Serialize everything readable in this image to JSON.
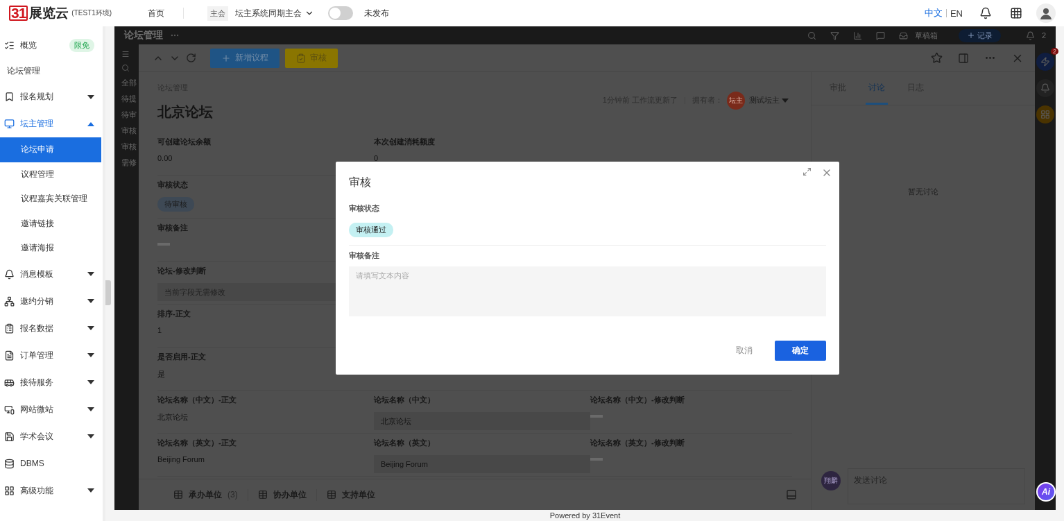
{
  "header": {
    "logo_mark": "31",
    "logo_text": "展览云",
    "env": "(TEST1环境)",
    "nav": [
      {
        "label": "首页"
      }
    ],
    "event_tag": "主会",
    "event_name": "坛主系统同期主会",
    "publish_toggle": {
      "on": false,
      "label": "未发布"
    },
    "languages": [
      {
        "label": "中文",
        "selected": true
      },
      {
        "label": "EN",
        "selected": false
      }
    ]
  },
  "sidebar": {
    "items": [
      {
        "kind": "link",
        "label": "概览",
        "badge": "限免"
      },
      {
        "kind": "heading",
        "label": "论坛管理"
      },
      {
        "kind": "group",
        "label": "报名规划",
        "expanded": false
      },
      {
        "kind": "group",
        "label": "坛主管理",
        "expanded": true,
        "children": [
          {
            "label": "论坛申请",
            "selected": true
          },
          {
            "label": "议程管理",
            "selected": false
          },
          {
            "label": "议程嘉宾关联管理",
            "selected": false
          },
          {
            "label": "邀请链接",
            "selected": false
          },
          {
            "label": "邀请海报",
            "selected": false
          }
        ]
      },
      {
        "kind": "group",
        "label": "消息模板",
        "expanded": false
      },
      {
        "kind": "group",
        "label": "邀约分销",
        "expanded": false
      },
      {
        "kind": "group",
        "label": "报名数据",
        "expanded": false
      },
      {
        "kind": "group",
        "label": "订单管理",
        "expanded": false
      },
      {
        "kind": "group",
        "label": "接待服务",
        "expanded": false
      },
      {
        "kind": "group",
        "label": "网站微站",
        "expanded": false
      },
      {
        "kind": "group",
        "label": "学术会议",
        "expanded": false
      },
      {
        "kind": "link",
        "label": "DBMS"
      },
      {
        "kind": "group",
        "label": "高级功能",
        "expanded": false
      }
    ]
  },
  "background_page": {
    "title": "论坛管理",
    "filters": [
      "全部",
      "待提",
      "待审",
      "审核",
      "审核",
      "需修"
    ],
    "drafts_label": "草稿箱",
    "add_record_label": "记录",
    "bell_count": "2",
    "rail_badge": "2"
  },
  "drawer": {
    "add_button": "新增议程",
    "review_button": "审核",
    "breadcrumb": "论坛管理",
    "title": "北京论坛",
    "updated": "1分钟前 工作流更新了",
    "owner_label": "拥有者：",
    "owner_avatar": "坛主",
    "owner_name": "测试坛主",
    "fields": [
      [
        {
          "kind": "text",
          "label": "可创建论坛余额",
          "value": "0.00"
        },
        {
          "kind": "text",
          "label": "本次创建消耗额度",
          "value": "0"
        }
      ],
      [
        {
          "kind": "tag",
          "label": "审核状态",
          "value": "待审核"
        }
      ],
      [
        {
          "kind": "empty",
          "label": "审核备注"
        }
      ],
      [
        {
          "kind": "input",
          "label": "论坛-修改判断",
          "placeholder": "当前字段无需修改"
        }
      ],
      [
        {
          "kind": "text",
          "label": "排序-正文",
          "value": "1"
        }
      ],
      [
        {
          "kind": "text",
          "label": "是否启用-正文",
          "value": "是"
        }
      ],
      [
        {
          "kind": "text",
          "label": "论坛名称（中文）-正文",
          "value": "北京论坛"
        },
        {
          "kind": "input",
          "label": "论坛名称（中文）",
          "value": "北京论坛"
        },
        {
          "kind": "empty",
          "label": "论坛名称（中文）-修改判断"
        }
      ],
      [
        {
          "kind": "text",
          "label": "论坛名称（英文）-正文",
          "value": "Beijing Forum"
        },
        {
          "kind": "input",
          "label": "论坛名称（英文）",
          "value": "Beijing Forum"
        },
        {
          "kind": "empty",
          "label": "论坛名称（英文）-修改判断"
        }
      ]
    ],
    "sub_tabs": [
      {
        "label": "承办单位",
        "count": "(3)"
      },
      {
        "label": "协办单位"
      },
      {
        "label": "支持单位"
      }
    ]
  },
  "discussion": {
    "tabs": [
      {
        "label": "审批",
        "selected": false
      },
      {
        "label": "讨论",
        "selected": true
      },
      {
        "label": "日志",
        "selected": false
      }
    ],
    "empty_text": "暂无讨论",
    "user_avatar": "翔麟",
    "input_placeholder": "发送讨论"
  },
  "modal": {
    "title": "审核",
    "status_label": "审核状态",
    "status_tag": "审核通过",
    "remark_label": "审核备注",
    "remark_placeholder": "请填写文本内容",
    "cancel": "取消",
    "confirm": "确定"
  },
  "ai_button": "Ai",
  "footer": "Powered by 31Event"
}
